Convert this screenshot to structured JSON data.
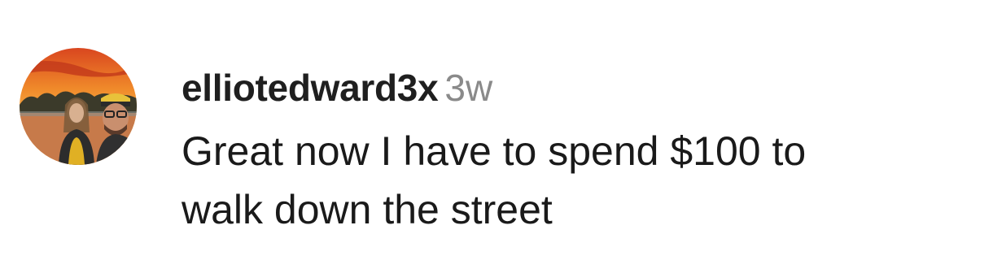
{
  "comment": {
    "username": "elliotedward3x",
    "time_ago": "3w",
    "text_lines": [
      "Great now I have to spend $100 to",
      "walk down the street"
    ]
  },
  "avatar": {
    "icon": "profile-photo-avatar",
    "colors": {
      "sky_top": "#d9461f",
      "sky_mid": "#f08a2a",
      "sky_low": "#f6b04a",
      "trees": "#3b3a2a",
      "ground": "#c77a4a"
    }
  }
}
